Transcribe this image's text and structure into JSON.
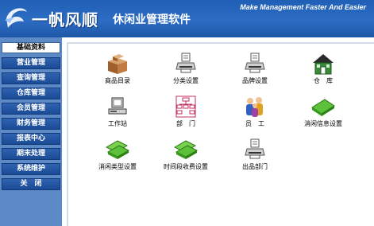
{
  "header": {
    "title": "一帆风顺",
    "subtitle": "休闲业管理软件",
    "slogan": "Make Management Faster And Easier"
  },
  "sidebar": {
    "active": "基础资料",
    "items": [
      "营业管理",
      "查询管理",
      "仓库管理",
      "会员管理",
      "财务管理",
      "报表中心",
      "期末处理",
      "系统维护",
      "关　闭"
    ]
  },
  "tiles": [
    {
      "label": "商品目录",
      "icon": "boxes-icon"
    },
    {
      "label": "分类设置",
      "icon": "printer-doc-icon"
    },
    {
      "label": "品牌设置",
      "icon": "printer-doc-icon"
    },
    {
      "label": "仓　库",
      "icon": "house-icon"
    },
    {
      "label": "工作站",
      "icon": "computer-icon"
    },
    {
      "label": "部　门",
      "icon": "org-chart-icon"
    },
    {
      "label": "员　工",
      "icon": "people-icon"
    },
    {
      "label": "消闲信息设置",
      "icon": "green-card-icon"
    },
    {
      "label": "消闲类型设置",
      "icon": "green-card-stack-icon"
    },
    {
      "label": "时间段收费设置",
      "icon": "green-card-stack-icon"
    },
    {
      "label": "出品部门",
      "icon": "printer-doc-icon"
    }
  ]
}
